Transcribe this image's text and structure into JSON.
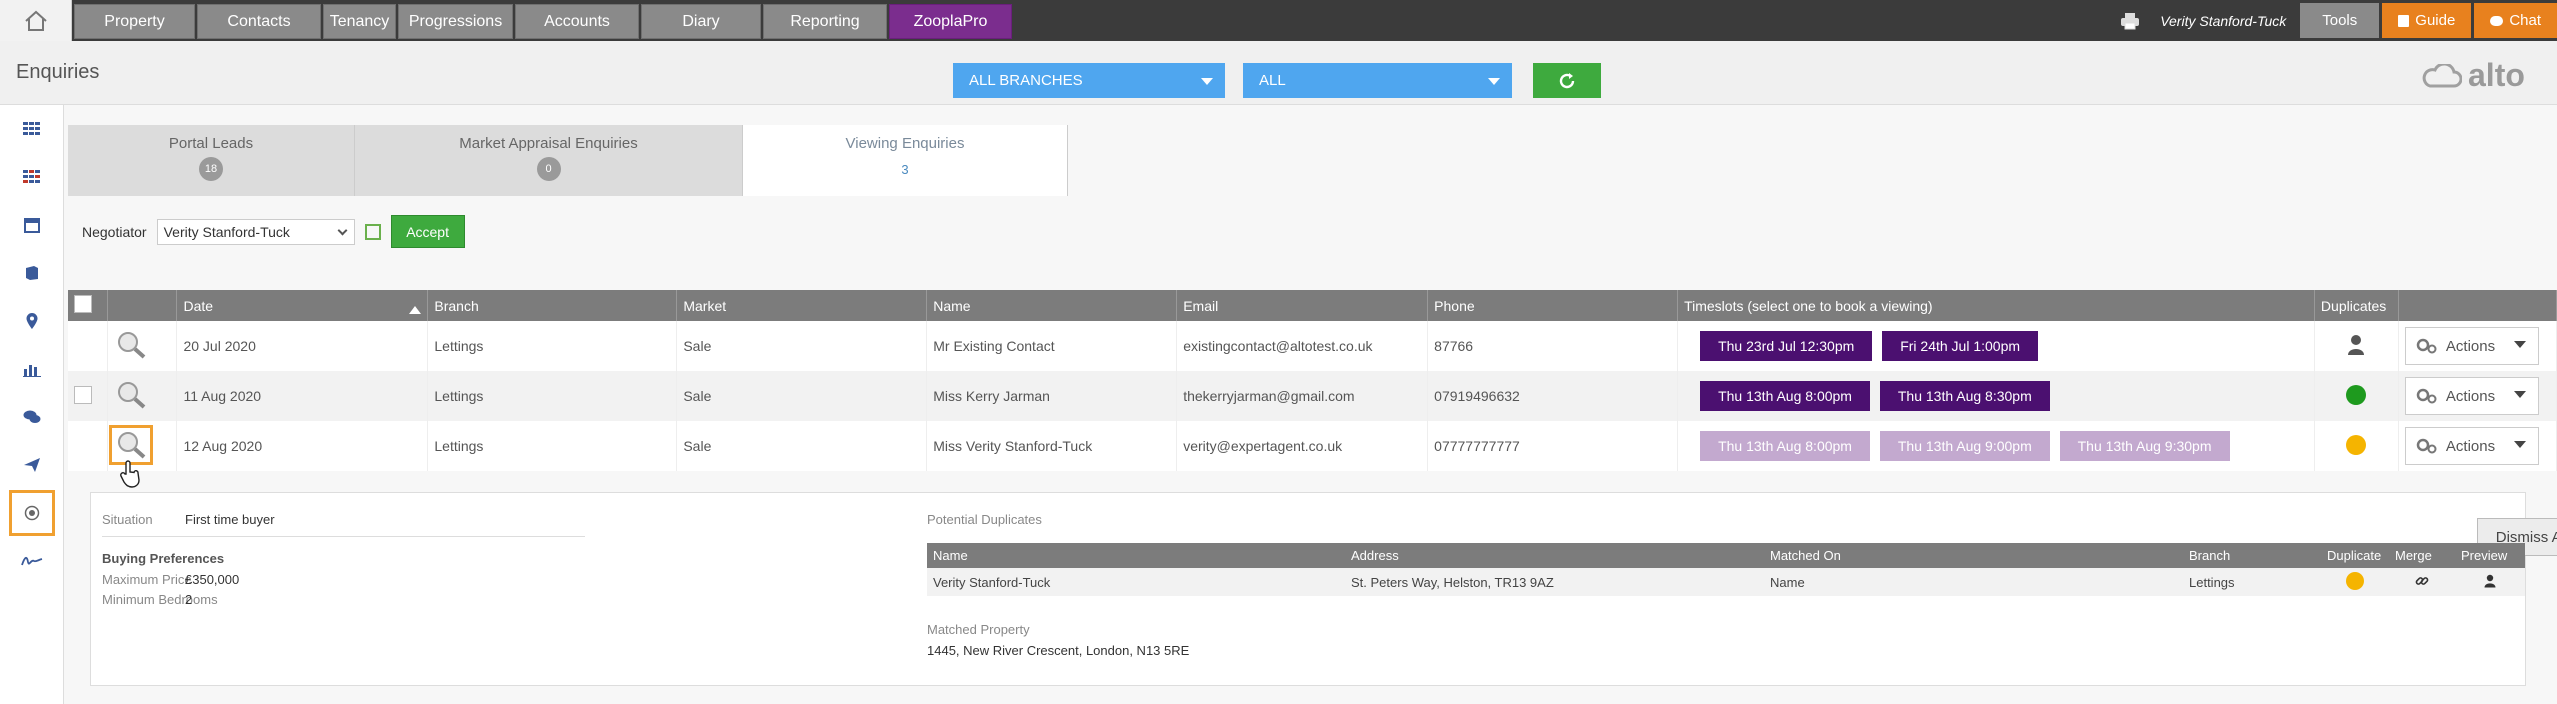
{
  "nav": {
    "tabs": [
      "Property",
      "Contacts",
      "Tenancy",
      "Progressions",
      "Accounts",
      "Diary",
      "Reporting",
      "ZooplaPro"
    ],
    "user": "Verity Stanford-Tuck",
    "tools": "Tools",
    "guide": "Guide",
    "chat": "Chat"
  },
  "header": {
    "title": "Enquiries",
    "branch_select": "ALL BRANCHES",
    "filter_select": "ALL",
    "logo_text": "alto"
  },
  "tabs": [
    {
      "label": "Portal Leads",
      "count": "18"
    },
    {
      "label": "Market Appraisal Enquiries",
      "count": "0"
    },
    {
      "label": "Viewing Enquiries",
      "count": "3"
    }
  ],
  "negotiator": {
    "label": "Negotiator",
    "value": "Verity Stanford-Tuck",
    "accept": "Accept"
  },
  "table": {
    "headers": {
      "date": "Date",
      "branch": "Branch",
      "market": "Market",
      "name": "Name",
      "email": "Email",
      "phone": "Phone",
      "timeslots": "Timeslots (select one to book a viewing)",
      "duplicates": "Duplicates"
    },
    "action_label": "Actions",
    "rows": [
      {
        "date": "20 Jul 2020",
        "branch": "Lettings",
        "market": "Sale",
        "name": "Mr Existing Contact",
        "email": "existingcontact@altotest.co.uk",
        "phone": "87766",
        "slots": [
          "Thu 23rd Jul 12:30pm",
          "Fri 24th Jul 1:00pm"
        ],
        "dup": "person"
      },
      {
        "date": "11 Aug 2020",
        "branch": "Lettings",
        "market": "Sale",
        "name": "Miss Kerry Jarman",
        "email": "thekerryjarman@gmail.com",
        "phone": "07919496632",
        "slots": [
          "Thu 13th Aug 8:00pm",
          "Thu 13th Aug 8:30pm"
        ],
        "dup": "green"
      },
      {
        "date": "12 Aug 2020",
        "branch": "Lettings",
        "market": "Sale",
        "name": "Miss Verity Stanford-Tuck",
        "email": "verity@expertagent.co.uk",
        "phone": "07777777777",
        "slots": [
          "Thu 13th Aug 8:00pm",
          "Thu 13th Aug 9:00pm",
          "Thu 13th Aug 9:30pm"
        ],
        "dup": "amber"
      }
    ]
  },
  "detail": {
    "situation_label": "Situation",
    "situation": "First time buyer",
    "prefs_title": "Buying Preferences",
    "max_price_label": "Maximum Price",
    "max_price": "£350,000",
    "min_beds_label": "Minimum Bedrooms",
    "min_beds": "2",
    "dups_title": "Potential Duplicates",
    "dismiss": "Dismiss All",
    "dup_headers": {
      "name": "Name",
      "address": "Address",
      "matched_on": "Matched On",
      "branch": "Branch",
      "duplicate": "Duplicate",
      "merge": "Merge",
      "preview": "Preview"
    },
    "dup_row": {
      "name": "Verity Stanford-Tuck",
      "address": "St. Peters Way, Helston, TR13 9AZ",
      "matched_on": "Name",
      "branch": "Lettings"
    },
    "matched_property_label": "Matched Property",
    "matched_property": "1445, New River Crescent, London, N13 5RE"
  },
  "colors": {
    "accent_blue": "#4fa6ef",
    "green": "#3eaa3e",
    "purple": "#4b1070",
    "orange": "#e8811e",
    "highlight": "#f0a030"
  }
}
